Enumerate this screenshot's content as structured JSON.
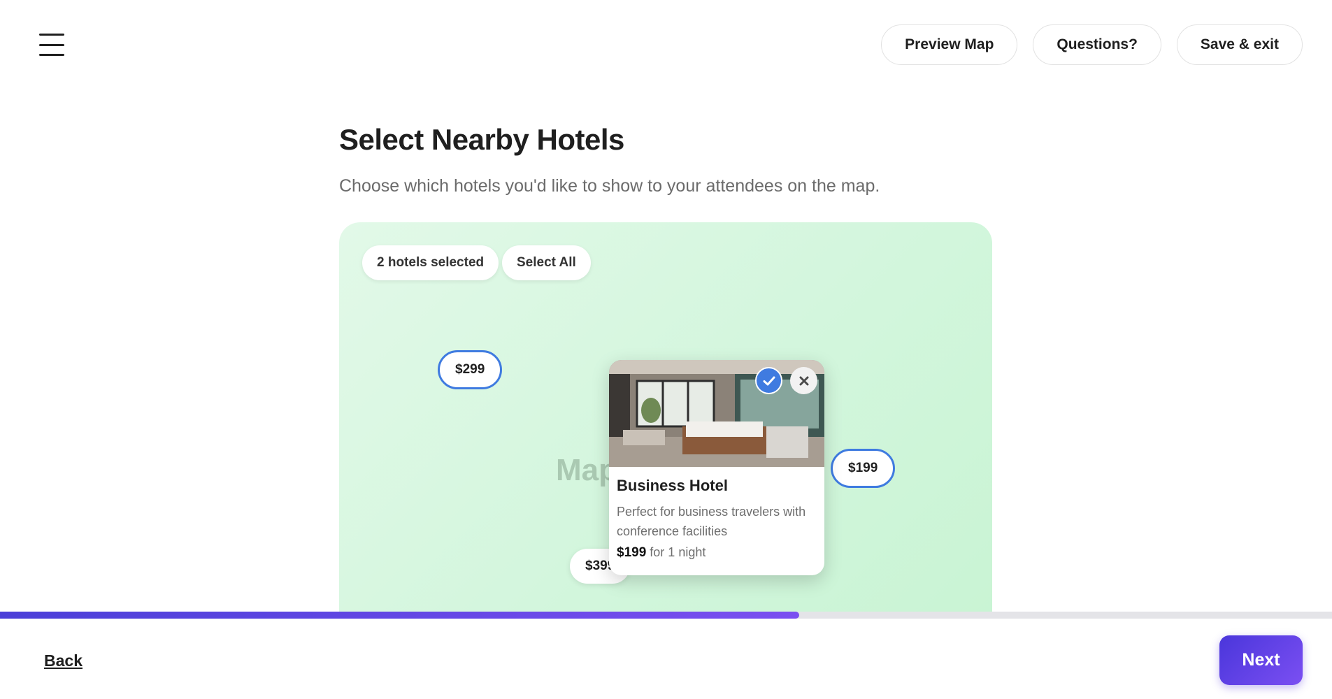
{
  "header": {
    "menu_icon": "hamburger-menu-icon",
    "actions": {
      "preview_map": "Preview Map",
      "questions": "Questions?",
      "save_exit": "Save & exit"
    }
  },
  "main": {
    "title": "Select Nearby Hotels",
    "subtitle": "Choose which hotels you'd like to show to your attendees on the map."
  },
  "map": {
    "selected_count_label": "2 hotels selected",
    "select_all_label": "Select All",
    "placeholder_text": "Map",
    "pins": [
      {
        "price": "$299",
        "selected": true
      },
      {
        "price": "$199",
        "selected": true
      },
      {
        "price": "$399",
        "selected": false
      }
    ],
    "popup": {
      "name": "Business Hotel",
      "description": "Perfect for business travelers with conference facilities",
      "price": "$199",
      "price_suffix": "for 1 night",
      "selected": true,
      "check_icon": "check-icon",
      "close_icon": "close-icon"
    }
  },
  "progress": {
    "fraction": 0.6
  },
  "footer": {
    "back_label": "Back",
    "next_label": "Next"
  },
  "colors": {
    "accent": "#4a36db",
    "accent_end": "#7b4ff2",
    "pin_selected": "#3f7be0",
    "map_bg": "#d3f6dd"
  }
}
